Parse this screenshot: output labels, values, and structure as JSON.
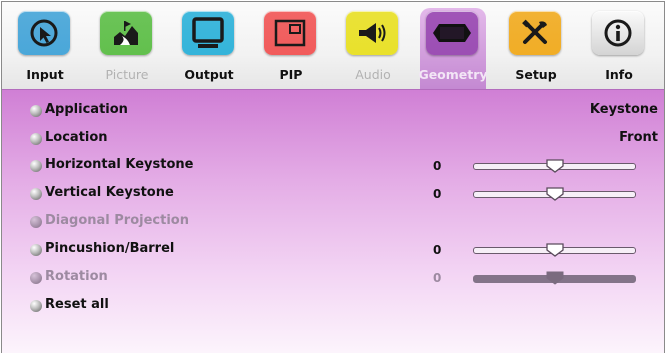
{
  "tabs": [
    {
      "label": "Input",
      "color": "#4aa7d9",
      "icon": "cursor-icon",
      "active": false,
      "dim": false
    },
    {
      "label": "Picture",
      "color": "#62c04d",
      "icon": "landscape-icon",
      "active": false,
      "dim": true
    },
    {
      "label": "Output",
      "color": "#34b4da",
      "icon": "monitor-icon",
      "active": false,
      "dim": false
    },
    {
      "label": "PIP",
      "color": "#f15b5b",
      "icon": "pip-icon",
      "active": false,
      "dim": false
    },
    {
      "label": "Audio",
      "color": "#e9e12b",
      "icon": "speaker-icon",
      "active": false,
      "dim": true
    },
    {
      "label": "Geometry",
      "color": "#9c4fb4",
      "icon": "geometry-icon",
      "active": true,
      "dim": false
    },
    {
      "label": "Setup",
      "color": "#f1ad26",
      "icon": "tools-icon",
      "active": false,
      "dim": false
    },
    {
      "label": "Info",
      "color": "#e5e5e5",
      "icon": "info-icon",
      "active": false,
      "dim": false
    }
  ],
  "menu": {
    "rows": [
      {
        "label": "Application",
        "value": "Keystone",
        "enabled": true
      },
      {
        "label": "Location",
        "value": "Front",
        "enabled": true
      },
      {
        "label": "Horizontal Keystone",
        "number": "0",
        "slider": 0.5,
        "enabled": true
      },
      {
        "label": "Vertical Keystone",
        "number": "0",
        "slider": 0.5,
        "enabled": true
      },
      {
        "label": "Diagonal Projection",
        "enabled": false
      },
      {
        "label": "Pincushion/Barrel",
        "number": "0",
        "slider": 0.5,
        "enabled": true
      },
      {
        "label": "Rotation",
        "number": "0",
        "slider": 0.5,
        "enabled": false
      },
      {
        "label": "Reset all",
        "enabled": true
      }
    ]
  }
}
